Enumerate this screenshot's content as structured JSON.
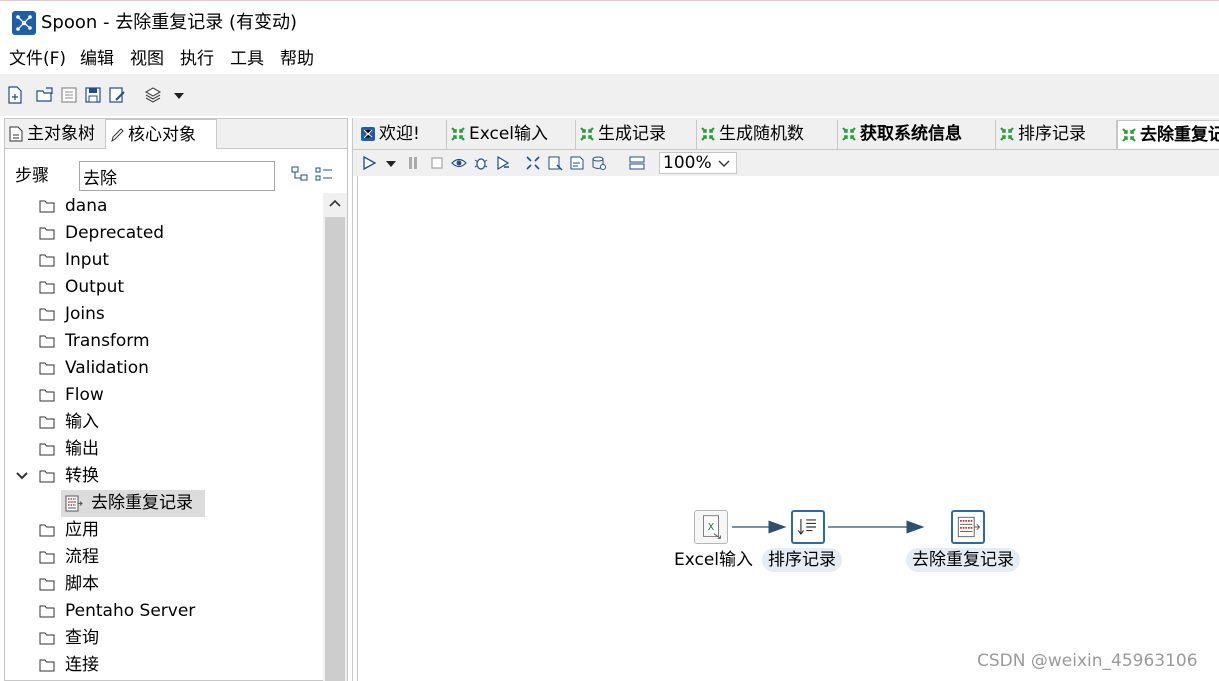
{
  "window": {
    "title": "Spoon - 去除重复记录 (有变动)"
  },
  "menu": {
    "items": [
      "文件(F)",
      "编辑",
      "视图",
      "执行",
      "工具",
      "帮助"
    ]
  },
  "left_panel": {
    "tabs": [
      "主对象树",
      "核心对象"
    ],
    "steps_label": "步骤",
    "search_value": "去除",
    "tree": [
      {
        "label": "dana"
      },
      {
        "label": "Deprecated"
      },
      {
        "label": "Input"
      },
      {
        "label": "Output"
      },
      {
        "label": "Joins"
      },
      {
        "label": "Transform"
      },
      {
        "label": "Validation"
      },
      {
        "label": "Flow"
      },
      {
        "label": "输入"
      },
      {
        "label": "输出"
      },
      {
        "label": "转换",
        "expanded": true
      },
      {
        "label": "去除重复记录",
        "leaf": true,
        "selected": true
      },
      {
        "label": "应用"
      },
      {
        "label": "流程"
      },
      {
        "label": "脚本"
      },
      {
        "label": "Pentaho Server"
      },
      {
        "label": "查询"
      },
      {
        "label": "连接"
      }
    ]
  },
  "tabs": [
    {
      "label": "欢迎!",
      "icon": "spoon-icon"
    },
    {
      "label": "Excel输入",
      "icon": "transformation-icon"
    },
    {
      "label": "生成记录",
      "icon": "transformation-icon"
    },
    {
      "label": "生成随机数",
      "icon": "transformation-icon"
    },
    {
      "label": "获取系统信息",
      "icon": "transformation-icon",
      "bold": true
    },
    {
      "label": "排序记录",
      "icon": "transformation-icon"
    },
    {
      "label": "去除重复记录",
      "icon": "transformation-icon",
      "bold": true,
      "active": true
    }
  ],
  "canvas_toolbar": {
    "zoom": "100%"
  },
  "canvas": {
    "steps": [
      {
        "label": "Excel输入",
        "icon": "excel-input-icon"
      },
      {
        "label": "排序记录",
        "icon": "sort-rows-icon"
      },
      {
        "label": "去除重复记录",
        "icon": "unique-rows-icon"
      }
    ]
  },
  "watermark": "CSDN @weixin_45963106",
  "colors": {
    "accent": "#1f5fa8",
    "transformation_green": "#2a9d3a",
    "step_border": "#2b6aa8",
    "selected_row": "#dcdcdc"
  }
}
